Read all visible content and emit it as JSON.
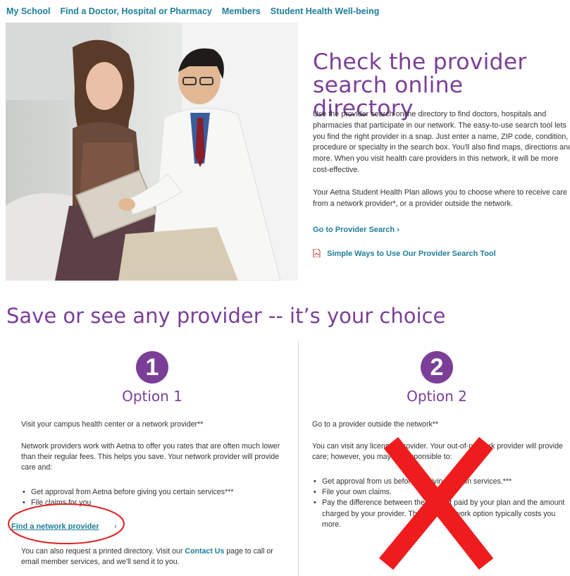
{
  "nav": {
    "items": [
      "My School",
      "Find a Doctor, Hospital or Pharmacy",
      "Members",
      "Student Health Well-being"
    ]
  },
  "hero": {
    "title_line1": "Check the provider",
    "title_line2": "search online directory",
    "para1": "Use the provider search online directory to find doctors, hospitals and pharmacies that participate in our network. The easy-to-use search tool lets you find the right provider in a snap. Just enter a name, ZIP code, condition, procedure or specialty in the search box. You'll also find maps, directions and more. When you visit health care providers in this network, it will be more cost-effective.",
    "para2": "Your Aetna Student Health Plan allows you to choose where to receive care from a network provider*, or a provider outside the network.",
    "provider_search_link": "Go to Provider Search",
    "provider_search_chevron": "›",
    "pdf_link": "Simple Ways to Use Our Provider Search Tool",
    "pdf_icon": "pdf-icon"
  },
  "section": {
    "title": "Save or see any provider -- it’s your choice"
  },
  "option1": {
    "number": "1",
    "title": "Option 1",
    "intro": "Visit your campus health center or a network provider**",
    "body": "Network providers work with Aetna to offer you rates that are often much lower than their regular fees. This helps you save. Your network provider will provide care and:",
    "bullets": [
      "Get approval from Aetna before giving you certain services***",
      "File claims for you"
    ],
    "find_link": "Find a network provider",
    "find_chevron": "›",
    "footer_pre": "You can also request a printed directory. Visit our ",
    "footer_link": "Contact Us",
    "footer_post": " page to call or email member services, and we'll send it to you."
  },
  "option2": {
    "number": "2",
    "title": "Option 2",
    "intro": "Go to a provider outside the network**",
    "body": "You can visit any licensed provider. Your out-of-network provider will provide care; however, you may be responsible to:",
    "bullets": [
      "Get approval from us before receiving certain services.***",
      "File your own claims.",
      "Pay the difference between the amount paid by your plan and the amount charged by your provider. The out-of-network option typically costs you more."
    ]
  },
  "annotations": {
    "circle_color": "#e02020",
    "x_color": "#ee1c1c"
  },
  "colors": {
    "brand_purple": "#7b3f98",
    "link_teal": "#1d7f99"
  }
}
